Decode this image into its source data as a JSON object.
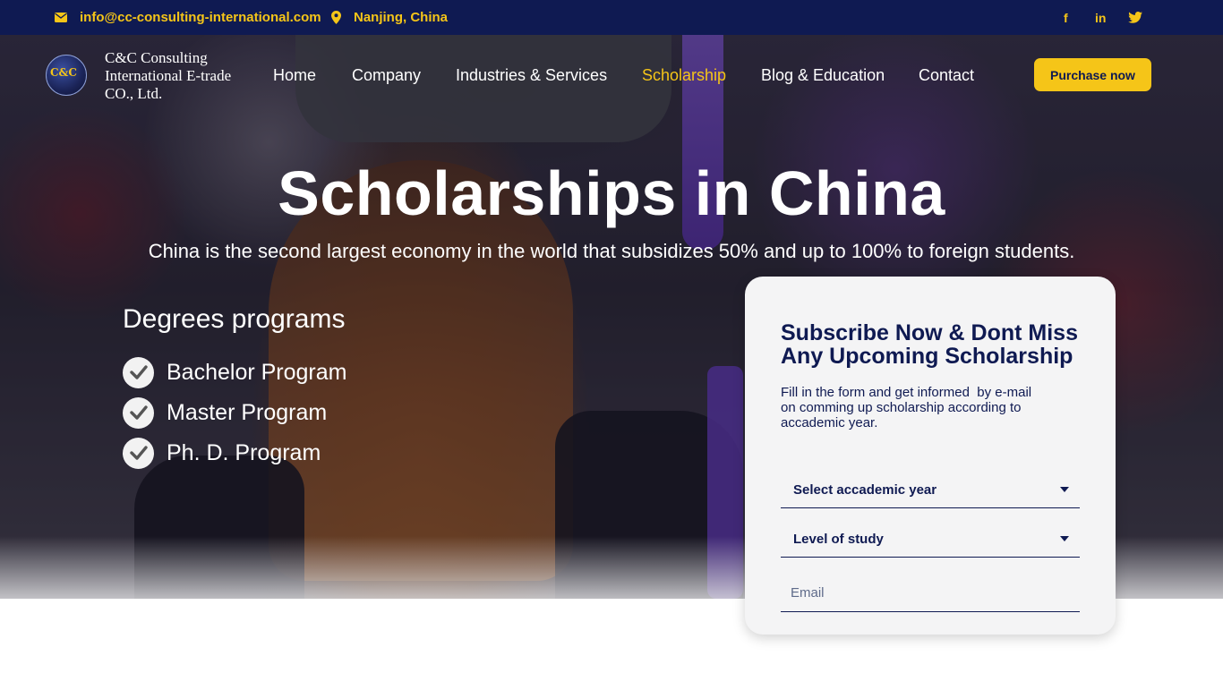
{
  "topbar": {
    "email": "info@cc-consulting-international.com",
    "location": "Nanjing, China",
    "social": {
      "facebook": "f",
      "linkedin": "in"
    }
  },
  "header": {
    "logo_text": "C&C",
    "brand_line1": "C&C Consulting",
    "brand_line2": "International E-trade",
    "brand_line3": "CO., Ltd.",
    "nav": [
      "Home",
      "Company",
      "Industries & Services",
      "Scholarship",
      "Blog & Education",
      "Contact"
    ],
    "active_nav": "Scholarship",
    "purchase_label": "Purchase now"
  },
  "hero": {
    "title": "Scholarships in China",
    "subtitle": "China is the second largest economy in the world that subsidizes 50% and up to 100% to foreign students.",
    "degrees_title": "Degrees programs",
    "programs": [
      "Bachelor Program",
      "Master Program",
      "Ph. D. Program"
    ]
  },
  "subscribe": {
    "title_line1": "Subscribe Now & Dont Miss",
    "title_line2": "Any Upcoming Scholarship",
    "text_line1": "Fill in the form and get informed  by e-mail",
    "text_line2": "on comming up scholarship according to",
    "text_line3": "accademic year.",
    "year_select": "Select accademic year",
    "level_select": "Level of study",
    "email_placeholder": "Email"
  },
  "colors": {
    "navy": "#0f1a52",
    "accent": "#f5c518",
    "card": "#f4f4f5"
  }
}
